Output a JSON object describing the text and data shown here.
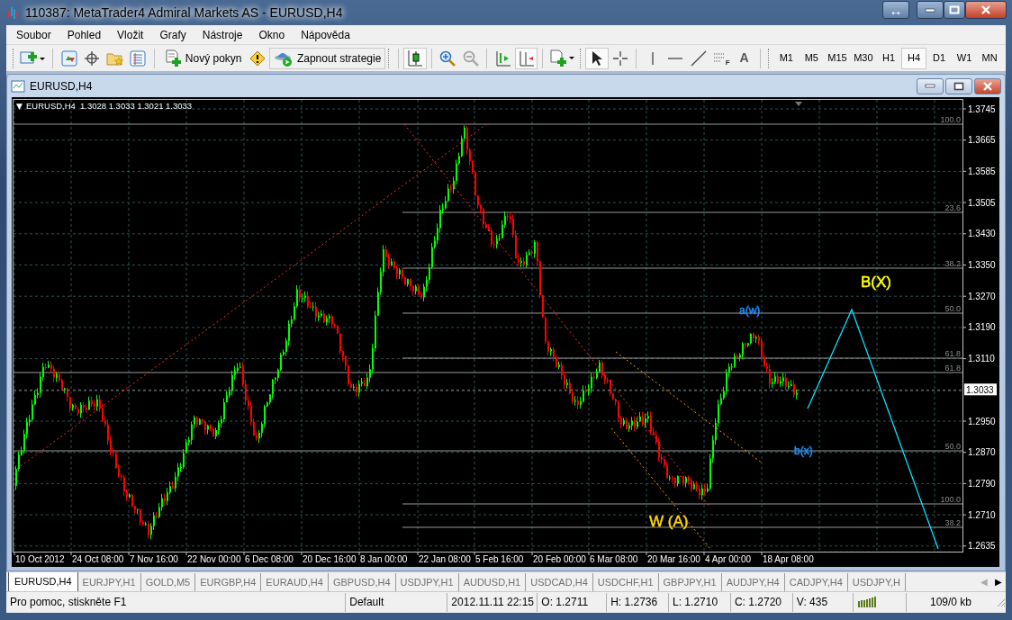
{
  "window": {
    "title": "110387: MetaTrader4 Admiral Markets AS - EURUSD,H4",
    "arrange_glyph": "↔"
  },
  "menu": [
    {
      "label": "Soubor"
    },
    {
      "label": "Pohled"
    },
    {
      "label": "Vložit"
    },
    {
      "label": "Grafy"
    },
    {
      "label": "Nástroje"
    },
    {
      "label": "Okno"
    },
    {
      "label": "Nápověda"
    }
  ],
  "toolbar": {
    "buttons": [
      {
        "label": "Nový pokyn"
      },
      {
        "label": "Zapnout strategie"
      }
    ],
    "tools": [
      {
        "kind": "cursor",
        "selected": true
      },
      {
        "kind": "crosshair",
        "selected": false
      },
      {
        "kind": "vline",
        "selected": false
      },
      {
        "kind": "hline",
        "selected": false
      },
      {
        "kind": "trend",
        "selected": false
      },
      {
        "kind": "fib",
        "label": "F",
        "selected": false
      },
      {
        "kind": "text",
        "label": "A",
        "selected": false
      }
    ],
    "timeframes": [
      {
        "label": "M1",
        "selected": false
      },
      {
        "label": "M5",
        "selected": false
      },
      {
        "label": "M15",
        "selected": false
      },
      {
        "label": "M30",
        "selected": false
      },
      {
        "label": "H1",
        "selected": false
      },
      {
        "label": "H4",
        "selected": true
      },
      {
        "label": "D1",
        "selected": false
      },
      {
        "label": "W1",
        "selected": false
      },
      {
        "label": "MN",
        "selected": false
      }
    ]
  },
  "chart_window": {
    "title": "EURUSD,H4",
    "header": {
      "marker": "▼",
      "symbol": "EURUSD,H4",
      "quotes": "1.3028 1.3033 1.3021 1.3033"
    },
    "price_ticks": [
      {
        "label": "1.3745",
        "kind": "tick"
      },
      {
        "label": "1.3665",
        "kind": "tick"
      },
      {
        "label": "1.3585",
        "kind": "tick"
      },
      {
        "label": "1.3505",
        "kind": "tick"
      },
      {
        "label": "1.3430",
        "kind": "tick"
      },
      {
        "label": "1.3350",
        "kind": "tick"
      },
      {
        "label": "1.3270",
        "kind": "tick"
      },
      {
        "label": "1.3190",
        "kind": "tick"
      },
      {
        "label": "1.3110",
        "kind": "tick"
      },
      {
        "label": "1.3033",
        "kind": "current"
      },
      {
        "label": "1.2950",
        "kind": "tick"
      },
      {
        "label": "1.2870",
        "kind": "tick"
      },
      {
        "label": "1.2790",
        "kind": "tick"
      },
      {
        "label": "1.2710",
        "kind": "tick"
      },
      {
        "label": "1.2635",
        "kind": "tick"
      }
    ],
    "time_ticks": [
      "10 Oct 2012",
      "24 Oct 08:00",
      "7 Nov 16:00",
      "22 Nov 00:00",
      "6 Dec 08:00",
      "20 Dec 16:00",
      "8 Jan 00:00",
      "22 Jan 08:00",
      "5 Feb 16:00",
      "20 Feb 00:00",
      "6 Mar 08:00",
      "20 Mar 16:00",
      "4 Apr 00:00",
      "18 Apr 08:00"
    ],
    "fib_levels": [
      {
        "label": "100.0"
      },
      {
        "label": "23.6"
      },
      {
        "label": "38.2"
      },
      {
        "label": "50.0"
      },
      {
        "label": "61.8"
      },
      {
        "label": "61.8"
      },
      {
        "label": "50.0"
      },
      {
        "label": "100.0"
      },
      {
        "label": "38.2"
      }
    ],
    "wave_labels": [
      {
        "label": "B(X)",
        "color": "#ffff00"
      },
      {
        "label": "a(w)",
        "color": "#1e90ff"
      },
      {
        "label": "b(x)",
        "color": "#1e90ff"
      },
      {
        "label": "W (A)",
        "color": "#ffd700"
      }
    ]
  },
  "tabs": [
    {
      "label": "EURUSD,H4",
      "selected": true
    },
    {
      "label": "EURJPY,H1",
      "selected": false
    },
    {
      "label": "GOLD,M5",
      "selected": false
    },
    {
      "label": "EURGBP,H4",
      "selected": false
    },
    {
      "label": "EURAUD,H4",
      "selected": false
    },
    {
      "label": "GBPUSD,H4",
      "selected": false
    },
    {
      "label": "USDJPY,H1",
      "selected": false
    },
    {
      "label": "AUDUSD,H1",
      "selected": false
    },
    {
      "label": "USDCAD,H4",
      "selected": false
    },
    {
      "label": "USDCHF,H1",
      "selected": false
    },
    {
      "label": "GBPJPY,H1",
      "selected": false
    },
    {
      "label": "AUDJPY,H4",
      "selected": false
    },
    {
      "label": "CADJPY,H4",
      "selected": false
    },
    {
      "label": "USDJPY,H",
      "selected": false
    }
  ],
  "tab_scroll": {
    "left": "◀",
    "right": "▶",
    "left_disabled": true
  },
  "status_bar": {
    "help": "Pro pomoc, stiskněte F1",
    "profile": "Default",
    "time": "2012.11.11 22:15",
    "open": "O: 1.2711",
    "high": "H: 1.2736",
    "low": "L: 1.2710",
    "close": "C: 1.2720",
    "volume": "V: 435",
    "traffic": "109/0 kb"
  }
}
